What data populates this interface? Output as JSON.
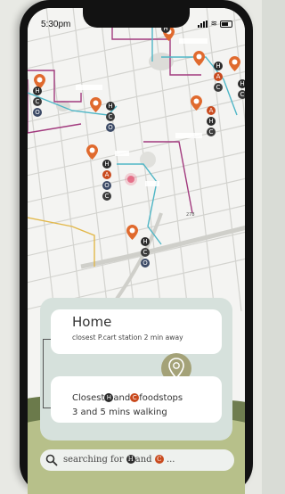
{
  "status_bar": {
    "time": "5:30pm"
  },
  "map": {
    "badges": {
      "h": "H",
      "a": "A",
      "c": "C",
      "o": "O"
    },
    "route_colors": {
      "magenta": "#a23a7e",
      "teal": "#4fb6c6",
      "yellow": "#e2b84a"
    },
    "pin_color": "#e06a2e",
    "highway_label": "278"
  },
  "home_card": {
    "title": "Home",
    "subtitle": "closest P.cart station 2 min away"
  },
  "food_card": {
    "prefix": "Closest",
    "badge_h": "H",
    "connector": "and",
    "badge_c": "C",
    "suffix": "foodstops",
    "line2": "3 and 5 mins walking"
  },
  "search": {
    "prefix": "searching for",
    "badge_h": "H",
    "connector": "and",
    "badge_c": "C",
    "suffix": "..."
  }
}
